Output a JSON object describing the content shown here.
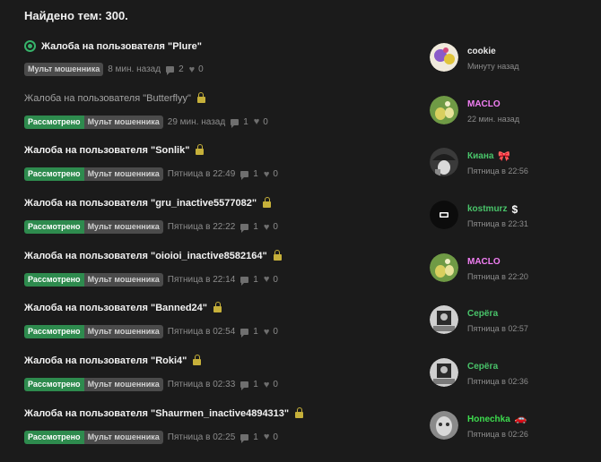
{
  "header": {
    "count_text": "Найдено тем: 300."
  },
  "threads": [
    {
      "title": "Жалоба на пользователя \"Plure\"",
      "read": false,
      "watched": true,
      "locked": false,
      "badges": [
        {
          "text": "Мульт мошенника",
          "kind": "grey"
        }
      ],
      "time": "8 мин. назад",
      "comments": "2",
      "likes": "0",
      "last_user": "cookie",
      "last_user_color": "#e8e8e8",
      "last_user_icon": "",
      "last_time": "Минуту назад",
      "avatar_icon": "cartoon-avatar-icon",
      "avatar_colors": [
        "#f0eadc",
        "#8a5bc9"
      ]
    },
    {
      "title": "Жалоба на пользователя \"Butterflyy\"",
      "read": true,
      "watched": false,
      "locked": true,
      "badges": [
        {
          "text": "Рассмотрено",
          "kind": "green"
        },
        {
          "text": "Мульт мошенника",
          "kind": "grey"
        }
      ],
      "time": "29 мин. назад",
      "comments": "1",
      "likes": "0",
      "last_user": "MACLO",
      "last_user_color": "#f27ff4",
      "last_user_icon": "",
      "last_time": "22 мин. назад",
      "avatar_icon": "duck-avatar-icon",
      "avatar_colors": [
        "#6f9a45",
        "#d9cf5e"
      ]
    },
    {
      "title": "Жалоба на пользователя \"Sonlik\"",
      "read": false,
      "watched": false,
      "locked": true,
      "badges": [
        {
          "text": "Рассмотрено",
          "kind": "green"
        },
        {
          "text": "Мульт мошенника",
          "kind": "grey"
        }
      ],
      "time": "Пятница в 22:49",
      "comments": "1",
      "likes": "0",
      "last_user": "Киана",
      "last_user_color": "#49c46a",
      "last_user_icon": "🎀",
      "last_time": "Пятница в 22:56",
      "avatar_icon": "girl-avatar-icon",
      "avatar_colors": [
        "#3a3a3a",
        "#d9d9d9"
      ]
    },
    {
      "title": "Жалоба на пользователя \"gru_inactive5577082\"",
      "read": false,
      "watched": false,
      "locked": true,
      "badges": [
        {
          "text": "Рассмотрено",
          "kind": "green"
        },
        {
          "text": "Мульт мошенника",
          "kind": "grey"
        }
      ],
      "time": "Пятница в 22:22",
      "comments": "1",
      "likes": "0",
      "last_user": "kostmurz",
      "last_user_color": "#49c46a",
      "last_user_icon": "$",
      "last_time": "Пятница в 22:31",
      "avatar_icon": "logo-avatar-icon",
      "avatar_colors": [
        "#0c0c0c",
        "#ffffff"
      ]
    },
    {
      "title": "Жалоба на пользователя \"oioioi_inactive8582164\"",
      "read": false,
      "watched": false,
      "locked": true,
      "badges": [
        {
          "text": "Рассмотрено",
          "kind": "green"
        },
        {
          "text": "Мульт мошенника",
          "kind": "grey"
        }
      ],
      "time": "Пятница в 22:14",
      "comments": "1",
      "likes": "0",
      "last_user": "MACLO",
      "last_user_color": "#f27ff4",
      "last_user_icon": "",
      "last_time": "Пятница в 22:20",
      "avatar_icon": "duck-avatar-icon",
      "avatar_colors": [
        "#6f9a45",
        "#d9cf5e"
      ]
    },
    {
      "title": "Жалоба на пользователя \"Banned24\"",
      "read": false,
      "watched": false,
      "locked": true,
      "badges": [
        {
          "text": "Рассмотрено",
          "kind": "green"
        },
        {
          "text": "Мульт мошенника",
          "kind": "grey"
        }
      ],
      "time": "Пятница в 02:54",
      "comments": "1",
      "likes": "0",
      "last_user": "Серёга",
      "last_user_color": "#49c46a",
      "last_user_icon": "",
      "last_time": "Пятница в 02:57",
      "avatar_icon": "photo-avatar-icon",
      "avatar_colors": [
        "#cfcfcf",
        "#2a2a2a"
      ]
    },
    {
      "title": "Жалоба на пользователя \"Roki4\"",
      "read": false,
      "watched": false,
      "locked": true,
      "badges": [
        {
          "text": "Рассмотрено",
          "kind": "green"
        },
        {
          "text": "Мульт мошенника",
          "kind": "grey"
        }
      ],
      "time": "Пятница в 02:33",
      "comments": "1",
      "likes": "0",
      "last_user": "Серёга",
      "last_user_color": "#49c46a",
      "last_user_icon": "",
      "last_time": "Пятница в 02:36",
      "avatar_icon": "photo-avatar-icon",
      "avatar_colors": [
        "#cfcfcf",
        "#2a2a2a"
      ]
    },
    {
      "title": "Жалоба на пользователя \"Shaurmen_inactive4894313\"",
      "read": false,
      "watched": false,
      "locked": true,
      "badges": [
        {
          "text": "Рассмотрено",
          "kind": "green"
        },
        {
          "text": "Мульт мошенника",
          "kind": "grey"
        }
      ],
      "time": "Пятница в 02:25",
      "comments": "1",
      "likes": "0",
      "last_user": "Honechka",
      "last_user_color": "#3ddc4e",
      "last_user_icon": "🚗",
      "last_time": "Пятница в 02:26",
      "avatar_icon": "animal-avatar-icon",
      "avatar_colors": [
        "#8a8a8a",
        "#d8d8d8"
      ]
    }
  ]
}
